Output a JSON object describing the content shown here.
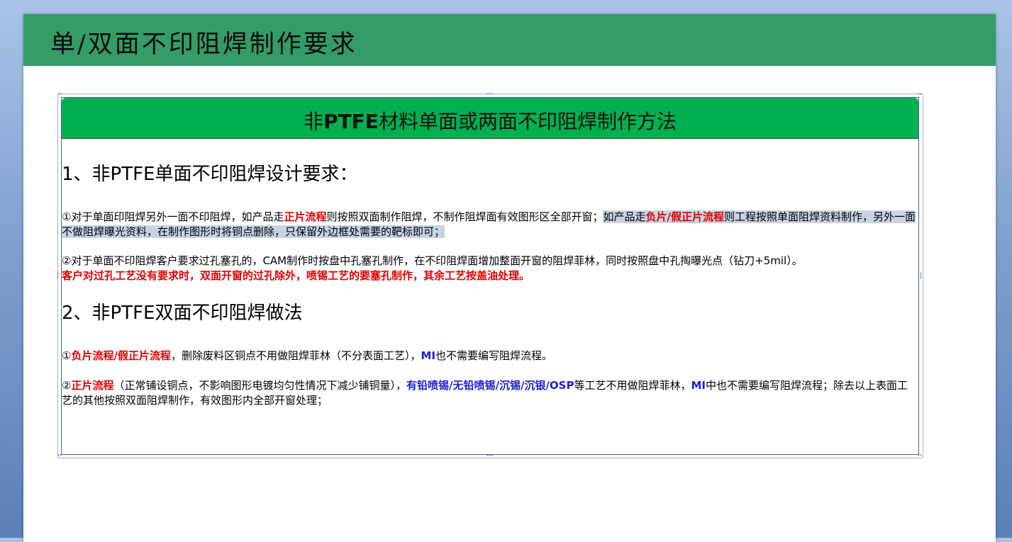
{
  "slide": {
    "title": "单/双面不印阻焊制作要求"
  },
  "box": {
    "title_pre": "非",
    "title_bold": "PTFE",
    "title_post": "材料单面或两面不印阻焊制作方法"
  },
  "section1": {
    "heading": "1、非PTFE单面不印阻焊设计要求：",
    "p1": {
      "prefix": "①对于单面印阻焊另外一面不印阻焊，如产品走",
      "red1": "正片流程",
      "mid": "则按照双面制作阻焊，不制作阻焊面有效图形区全部开窗；",
      "hl_prefix": "如产品走",
      "red2": "负片/假正片流程",
      "hl_rest": "则工程按照单面阻焊资料制作，另外一面不做阻焊曝光资料，在制作图形时将铜点删除，只保留外边框处需要的靶标即可；"
    },
    "p2": {
      "text": "②对于单面不印阻焊客户要求过孔塞孔的，CAM制作时按盘中孔塞孔制作，在不印阻焊面增加整面开窗的阻焊菲林，同时按照盘中孔掏曝光点（钻刀+5mil）。",
      "red": "客户对过孔工艺没有要求时，双面开窗的过孔除外，喷锡工艺的要塞孔制作，其余工艺按盖油处理。"
    }
  },
  "section2": {
    "heading": "2、非PTFE双面不印阻焊做法",
    "p1": {
      "circle": "①",
      "red": "负片流程/假正片流程",
      "mid": "，删除废料区铜点不用做阻焊菲林（不分表面工艺），",
      "blue": "MI",
      "tail": "也不需要编写阻焊流程。"
    },
    "p2": {
      "circle": "②",
      "red": "正片流程",
      "mid": "（正常铺设铜点，不影响图形电镀均匀性情况下减少铺铜量），",
      "blue1": "有铅喷锡/无铅喷锡/沉锡/沉银/OSP",
      "mid2": "等工艺不用做阻焊菲林，",
      "blue2": "MI",
      "tail": "中也不需要编写阻焊流程；除去以上表面工艺的其他按照双面阻焊制作，有效图形内全部开窗处理；"
    }
  },
  "colors": {
    "header_green": "#349c68",
    "box_green": "#00b050",
    "accent_red": "#e00000",
    "accent_blue": "#1f1fd0",
    "selection": "#c8d4e4"
  }
}
